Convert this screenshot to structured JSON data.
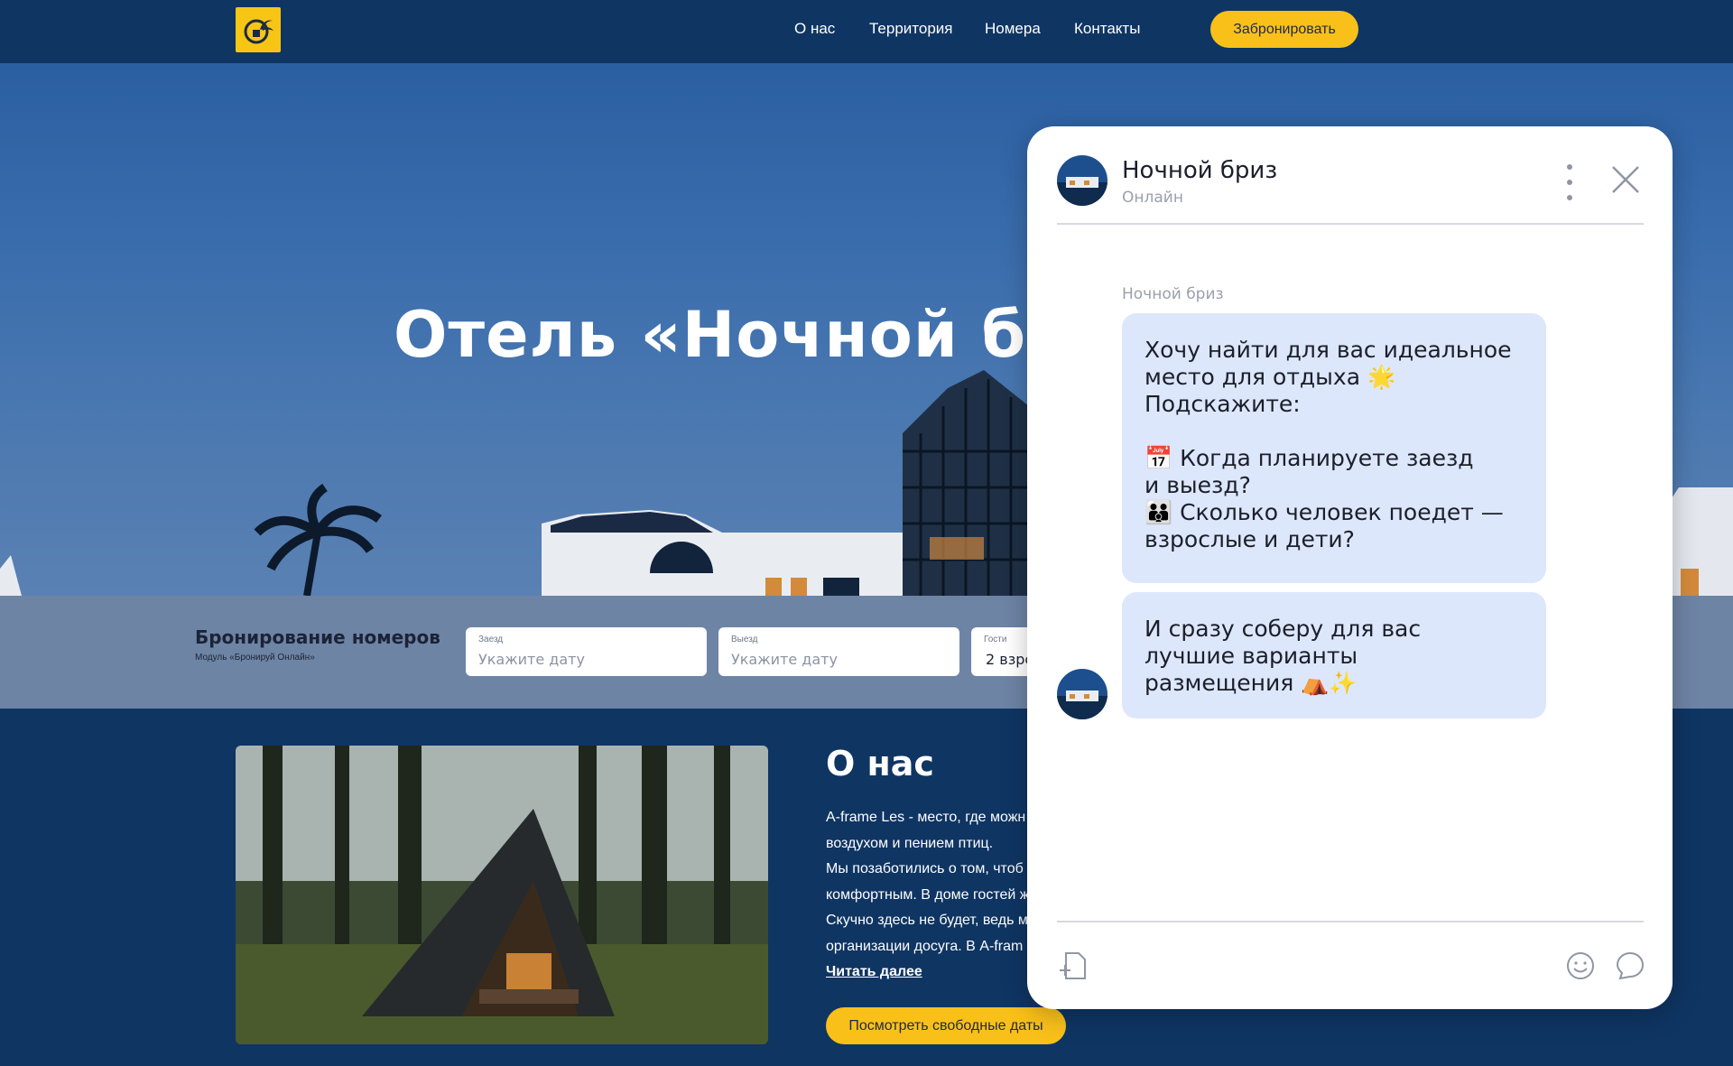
{
  "header": {
    "nav": [
      {
        "label": "О нас"
      },
      {
        "label": "Территория"
      },
      {
        "label": "Номера"
      },
      {
        "label": "Контакты"
      }
    ],
    "book_label": "Забронировать"
  },
  "hero": {
    "title": "Отель «Ночной б"
  },
  "booking": {
    "title": "Бронирование номеров",
    "subtitle": "Модуль «Бронируй Онлайн»",
    "checkin": {
      "label": "Заезд",
      "placeholder": "Укажите дату"
    },
    "checkout": {
      "label": "Выезд",
      "placeholder": "Укажите дату"
    },
    "guests": {
      "label": "Гости",
      "value": "2 взро"
    }
  },
  "about": {
    "title": "О нас",
    "lines": [
      "A-frame Les - место, где можн",
      "воздухом и пением птиц.",
      "Мы позаботились о том, чтоб",
      "комфортным. В доме гостей ж",
      "Скучно здесь не будет, ведь м",
      "организации досуга. В A-fram"
    ],
    "read_more": "Читать далее",
    "free_dates_label": "Посмотреть свободные даты"
  },
  "chat": {
    "name": "Ночной бриз",
    "status": "Онлайн",
    "sender_label": "Ночной бриз",
    "messages": [
      {
        "text": "Хочу найти для вас идеальное\nместо для отдыха 🌟\nПодскажите:\n\n📅 Когда планируете заезд\nи выезд?\n👪 Сколько человек поедет —\nвзрослые и дети?"
      },
      {
        "text": "И сразу соберу для вас\nлучшие варианты\nразмещения ⛺✨"
      }
    ]
  },
  "colors": {
    "navy": "#0f3563",
    "accent_yellow": "#f9c01a",
    "bubble": "#dde7fb"
  }
}
